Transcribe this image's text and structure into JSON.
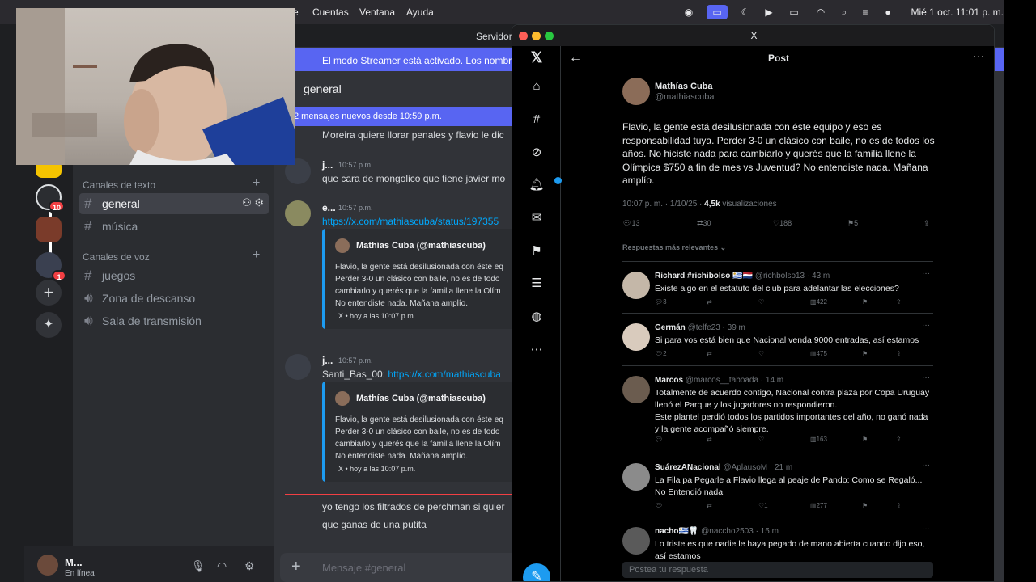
{
  "menubar": {
    "items": [
      "e",
      "Cuentas",
      "Ventana",
      "Ayuda"
    ],
    "clock": "Mié 1 oct. 11:01 p. m."
  },
  "discord": {
    "server_name": "Servidor",
    "streamer_banner": "El modo Streamer está activado. Los nombres c",
    "channel_title": "general",
    "new_messages": "2 mensajes nuevos desde 10:59 p.m.",
    "categories": {
      "text": "Canales de texto",
      "voice": "Canales de voz"
    },
    "text_channels": [
      {
        "name": "general"
      },
      {
        "name": "música"
      }
    ],
    "voice_channels": [
      {
        "name": "juegos",
        "icon": "hash"
      },
      {
        "name": "Zona de descanso",
        "icon": "speaker"
      },
      {
        "name": "Sala de transmisión",
        "icon": "speaker"
      }
    ],
    "guild_badges": [
      "10",
      "1"
    ],
    "user": {
      "name": "M...",
      "status": "En línea"
    },
    "composer_placeholder": "Mensaje #general",
    "messages": [
      {
        "text": "Moreira quiere llorar penales y flavio le dic"
      },
      {
        "author": "j...",
        "time": "10:57 p.m.",
        "text": "que cara de mongolico que tiene javier mo"
      },
      {
        "author": "e...",
        "time": "10:57 p.m.",
        "text": "https://x.com/mathiascuba/status/197355"
      },
      {
        "author": "j...",
        "time": "10:57 p.m.",
        "prefix": "Santi_Bas_00: ",
        "text": "https://x.com/mathiascuba"
      },
      {
        "text": "yo tengo los filtrados de perchman si quier"
      },
      {
        "text": "que ganas de una putita"
      }
    ],
    "embed": {
      "author": "Mathías Cuba (@mathiascuba)",
      "text_lines": [
        "Flavio, la gente está desilusionada con éste eq",
        "Perder 3-0 un clásico con baile, no es de todo",
        "cambiarlo y querés que la familia llene la Olím",
        "No entendiste nada. Mañana amplío."
      ],
      "footer": "X  •  hoy a las 10:07 p.m."
    }
  },
  "x": {
    "window_title": "X",
    "header_title": "Post",
    "post": {
      "name": "Mathías Cuba",
      "handle": "@mathiascuba",
      "text": "Flavio, la gente está desilusionada con éste equipo y eso es responsabilidad tuya. Perder 3-0 un clásico con baile, no es de todos los años. No hiciste nada para cambiarlo y querés que la familia llene la Olímpica $750 a fin de mes vs Juventud? No entendiste nada. Mañana amplío.",
      "meta": "10:07 p. m. · 1/10/25 · ",
      "views": "4,5k",
      "views_label": " visualizaciones",
      "replies": "13",
      "reposts": "30",
      "likes": "188",
      "bookmarks": "5"
    },
    "sort_label": "Respuestas más relevantes ⌄",
    "replies": [
      {
        "name": "Richard #richibolso 🇺🇾🇳🇱",
        "handle": "@richbolso13 · 43 m",
        "text": "Existe algo en el estatuto del club para adelantar las elecciones?",
        "comments": "3",
        "likes": "",
        "views": "422"
      },
      {
        "name": "Germán",
        "handle": "@telfe23 · 39 m",
        "text": "Si para vos está bien que Nacional venda 9000 entradas, así estamos",
        "comments": "2",
        "likes": "",
        "views": "475"
      },
      {
        "name": "Marcos",
        "handle": "@marcos__taboada · 14 m",
        "text": "Totalmente de acuerdo contigo, Nacional contra plaza por Copa Uruguay llenó el Parque y los jugadores no respondieron.\nEste plantel perdió todos los partidos importantes del año, no ganó nada y la gente acompañó siempre.",
        "comments": "",
        "likes": "",
        "views": "163"
      },
      {
        "name": "SuárezANacional",
        "handle": "@AplausoM · 21 m",
        "text": "La Fila pa Pegarle a Flavio llega al peaje de Pando: Como se Regaló... No Entendió nada",
        "comments": "",
        "likes": "1",
        "views": "277"
      },
      {
        "name": "nacho🇺🇾🦷",
        "handle": "@naccho2503 · 15 m",
        "text": "Lo triste es que nadie le haya pegado de mano abierta cuando dijo eso, así estamos",
        "comments": "",
        "likes": "",
        "views": ""
      }
    ],
    "reply_placeholder": "Postea tu respuesta"
  }
}
